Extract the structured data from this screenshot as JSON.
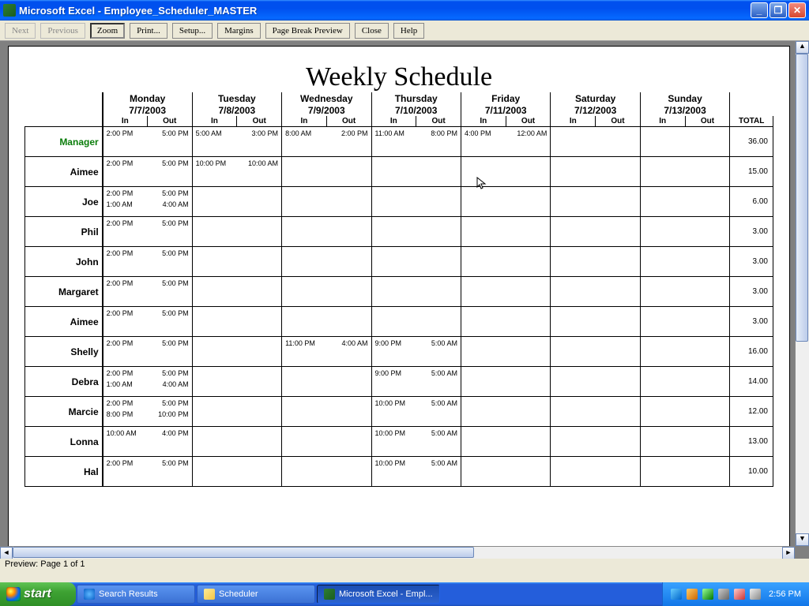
{
  "window": {
    "title": "Microsoft Excel - Employee_Scheduler_MASTER"
  },
  "toolbar": {
    "next": "Next",
    "previous": "Previous",
    "zoom": "Zoom",
    "print": "Print...",
    "setup": "Setup...",
    "margins": "Margins",
    "pagebreak": "Page Break Preview",
    "close": "Close",
    "help": "Help"
  },
  "status": {
    "text": "Preview: Page 1 of 1"
  },
  "schedule": {
    "title": "Weekly Schedule",
    "days": [
      {
        "name": "Monday",
        "date": "7/7/2003"
      },
      {
        "name": "Tuesday",
        "date": "7/8/2003"
      },
      {
        "name": "Wednesday",
        "date": "7/9/2003"
      },
      {
        "name": "Thursday",
        "date": "7/10/2003"
      },
      {
        "name": "Friday",
        "date": "7/11/2003"
      },
      {
        "name": "Saturday",
        "date": "7/12/2003"
      },
      {
        "name": "Sunday",
        "date": "7/13/2003"
      }
    ],
    "in_label": "In",
    "out_label": "Out",
    "total_label": "TOTAL",
    "rows": [
      {
        "name": "Manager",
        "manager": true,
        "total": "36.00",
        "shifts": [
          [
            {
              "in": "2:00 PM",
              "out": "5:00 PM"
            }
          ],
          [
            {
              "in": "5:00 AM",
              "out": "3:00 PM"
            }
          ],
          [
            {
              "in": "8:00 AM",
              "out": "2:00 PM"
            }
          ],
          [
            {
              "in": "11:00 AM",
              "out": "8:00 PM"
            }
          ],
          [
            {
              "in": "4:00 PM",
              "out": "12:00 AM"
            }
          ],
          [],
          []
        ]
      },
      {
        "name": "Aimee",
        "total": "15.00",
        "shifts": [
          [
            {
              "in": "2:00 PM",
              "out": "5:00 PM"
            }
          ],
          [
            {
              "in": "10:00 PM",
              "out": "10:00 AM"
            }
          ],
          [],
          [],
          [],
          [],
          []
        ]
      },
      {
        "name": "Joe",
        "total": "6.00",
        "shifts": [
          [
            {
              "in": "2:00 PM",
              "out": "5:00 PM"
            },
            {
              "in": "1:00 AM",
              "out": "4:00 AM"
            }
          ],
          [],
          [],
          [],
          [],
          [],
          []
        ]
      },
      {
        "name": "Phil",
        "total": "3.00",
        "shifts": [
          [
            {
              "in": "2:00 PM",
              "out": "5:00 PM"
            }
          ],
          [],
          [],
          [],
          [],
          [],
          []
        ]
      },
      {
        "name": "John",
        "total": "3.00",
        "shifts": [
          [
            {
              "in": "2:00 PM",
              "out": "5:00 PM"
            }
          ],
          [],
          [],
          [],
          [],
          [],
          []
        ]
      },
      {
        "name": "Margaret",
        "total": "3.00",
        "shifts": [
          [
            {
              "in": "2:00 PM",
              "out": "5:00 PM"
            }
          ],
          [],
          [],
          [],
          [],
          [],
          []
        ]
      },
      {
        "name": "Aimee",
        "total": "3.00",
        "shifts": [
          [
            {
              "in": "2:00 PM",
              "out": "5:00 PM"
            }
          ],
          [],
          [],
          [],
          [],
          [],
          []
        ]
      },
      {
        "name": "Shelly",
        "total": "16.00",
        "shifts": [
          [
            {
              "in": "2:00 PM",
              "out": "5:00 PM"
            }
          ],
          [],
          [
            {
              "in": "11:00 PM",
              "out": "4:00 AM"
            }
          ],
          [
            {
              "in": "9:00 PM",
              "out": "5:00 AM"
            }
          ],
          [],
          [],
          []
        ]
      },
      {
        "name": "Debra",
        "total": "14.00",
        "shifts": [
          [
            {
              "in": "2:00 PM",
              "out": "5:00 PM"
            },
            {
              "in": "1:00 AM",
              "out": "4:00 AM"
            }
          ],
          [],
          [],
          [
            {
              "in": "9:00 PM",
              "out": "5:00 AM"
            }
          ],
          [],
          [],
          []
        ]
      },
      {
        "name": "Marcie",
        "total": "12.00",
        "shifts": [
          [
            {
              "in": "2:00 PM",
              "out": "5:00 PM"
            },
            {
              "in": "8:00 PM",
              "out": "10:00 PM"
            }
          ],
          [],
          [],
          [
            {
              "in": "10:00 PM",
              "out": "5:00 AM"
            }
          ],
          [],
          [],
          []
        ]
      },
      {
        "name": "Lonna",
        "total": "13.00",
        "shifts": [
          [
            {
              "in": "10:00 AM",
              "out": "4:00 PM"
            }
          ],
          [],
          [],
          [
            {
              "in": "10:00 PM",
              "out": "5:00 AM"
            }
          ],
          [],
          [],
          []
        ]
      },
      {
        "name": "Hal",
        "total": "10.00",
        "shifts": [
          [
            {
              "in": "2:00 PM",
              "out": "5:00 PM"
            }
          ],
          [],
          [],
          [
            {
              "in": "10:00 PM",
              "out": "5:00 AM"
            }
          ],
          [],
          [],
          []
        ]
      }
    ]
  },
  "taskbar": {
    "start": "start",
    "items": [
      {
        "label": "Search Results",
        "icon": "ie"
      },
      {
        "label": "Scheduler",
        "icon": "folder"
      },
      {
        "label": "Microsoft Excel - Empl...",
        "icon": "xl",
        "active": true
      }
    ],
    "clock": "2:56 PM"
  }
}
